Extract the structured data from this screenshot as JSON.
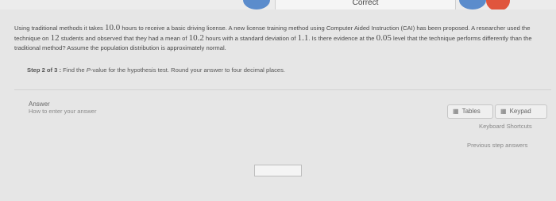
{
  "header": {
    "status_text": "Correct"
  },
  "question": {
    "p1": "Using traditional methods it takes ",
    "hours_value": "10.0",
    "p2": " hours to receive a basic driving license. A new license training method using Computer Aided Instruction (CAI) has been proposed. A researcher used the technique on ",
    "students_value": "12",
    "p3": " students and observed that they had a mean of ",
    "mean_value": "10.2",
    "p4": " hours with a standard deviation of ",
    "sd_value": "1.1",
    "p5": ". Is there evidence at the ",
    "alpha_value": "0.05",
    "p6": " level that the technique performs differently than the traditional method? Assume the population distribution is approximately normal."
  },
  "step": {
    "label": "Step 2 of 3 :",
    "text_a": " Find the ",
    "pvalue": "P",
    "text_b": "-value for the hypothesis test. Round your answer to four decimal places."
  },
  "answer": {
    "label": "Answer",
    "help_link": "How to enter your answer",
    "input_value": ""
  },
  "tools": {
    "tables_label": "Tables",
    "keypad_label": "Keypad",
    "shortcuts_label": "Keyboard Shortcuts",
    "previous_label": "Previous step answers"
  },
  "icons": {
    "nav_color": "#5b8ccc",
    "alert_color": "#e0553d"
  }
}
